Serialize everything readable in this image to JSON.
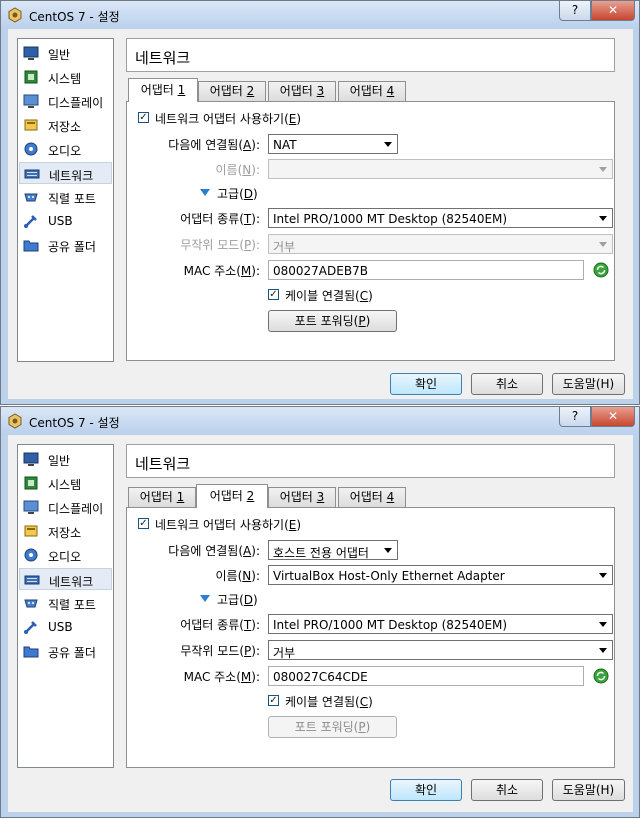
{
  "windows": [
    {
      "title": "CentOS 7 - 설정",
      "title_buttons": {
        "help": "?",
        "close": "✕"
      },
      "sidebar": [
        {
          "label": "일반",
          "icon": "general-icon"
        },
        {
          "label": "시스템",
          "icon": "system-icon"
        },
        {
          "label": "디스플레이",
          "icon": "display-icon"
        },
        {
          "label": "저장소",
          "icon": "storage-icon"
        },
        {
          "label": "오디오",
          "icon": "audio-icon"
        },
        {
          "label": "네트워크",
          "icon": "network-icon",
          "selected": true
        },
        {
          "label": "직렬 포트",
          "icon": "serial-port-icon"
        },
        {
          "label": "USB",
          "icon": "usb-icon"
        },
        {
          "label": "공유 폴더",
          "icon": "shared-folder-icon"
        }
      ],
      "section_title": "네트워크",
      "tabs": [
        {
          "pre": "어댑터 ",
          "key": "1",
          "post": ""
        },
        {
          "pre": "어댑터 ",
          "key": "2",
          "post": ""
        },
        {
          "pre": "어댑터 ",
          "key": "3",
          "post": ""
        },
        {
          "pre": "어댑터 ",
          "key": "4",
          "post": ""
        }
      ],
      "active_tab": 0,
      "enable_adapter": {
        "pre": "네트워크 어댑터 사용하기(",
        "key": "E",
        "post": ")",
        "checked": true
      },
      "attached_to": {
        "pre": "다음에 연결됨(",
        "key": "A",
        "post": "):",
        "value": "NAT"
      },
      "name": {
        "pre": "이름(",
        "key": "N",
        "post": "):",
        "value": "",
        "disabled": true
      },
      "advanced": {
        "pre": "고급(",
        "key": "D",
        "post": ")"
      },
      "adapter_type": {
        "pre": "어댑터 종류(",
        "key": "T",
        "post": "):",
        "value": "Intel PRO/1000 MT Desktop (82540EM)"
      },
      "promiscuous": {
        "pre": "무작위 모드(",
        "key": "P",
        "post": "):",
        "value": "거부",
        "disabled": true
      },
      "mac": {
        "pre": "MAC 주소(",
        "key": "M",
        "post": "):",
        "value": "080027ADEB7B"
      },
      "cable": {
        "pre": "케이블 연결됨(",
        "key": "C",
        "post": ")",
        "checked": true
      },
      "port_forwarding": {
        "pre": "포트 포워딩(",
        "key": "P",
        "post": ")",
        "disabled": false
      },
      "buttons": {
        "ok": "확인",
        "cancel": "취소",
        "help": "도움말(H)"
      }
    },
    {
      "title": "CentOS 7 - 설정",
      "title_buttons": {
        "help": "?",
        "close": "✕"
      },
      "sidebar": [
        {
          "label": "일반",
          "icon": "general-icon"
        },
        {
          "label": "시스템",
          "icon": "system-icon"
        },
        {
          "label": "디스플레이",
          "icon": "display-icon"
        },
        {
          "label": "저장소",
          "icon": "storage-icon"
        },
        {
          "label": "오디오",
          "icon": "audio-icon"
        },
        {
          "label": "네트워크",
          "icon": "network-icon",
          "selected": true
        },
        {
          "label": "직렬 포트",
          "icon": "serial-port-icon"
        },
        {
          "label": "USB",
          "icon": "usb-icon"
        },
        {
          "label": "공유 폴더",
          "icon": "shared-folder-icon"
        }
      ],
      "section_title": "네트워크",
      "tabs": [
        {
          "pre": "어댑터 ",
          "key": "1",
          "post": ""
        },
        {
          "pre": "어댑터 ",
          "key": "2",
          "post": ""
        },
        {
          "pre": "어댑터 ",
          "key": "3",
          "post": ""
        },
        {
          "pre": "어댑터 ",
          "key": "4",
          "post": ""
        }
      ],
      "active_tab": 1,
      "enable_adapter": {
        "pre": "네트워크 어댑터 사용하기(",
        "key": "E",
        "post": ")",
        "checked": true
      },
      "attached_to": {
        "pre": "다음에 연결됨(",
        "key": "A",
        "post": "):",
        "value": "호스트 전용 어댑터"
      },
      "name": {
        "pre": "이름(",
        "key": "N",
        "post": "):",
        "value": "VirtualBox Host-Only Ethernet Adapter",
        "disabled": false
      },
      "advanced": {
        "pre": "고급(",
        "key": "D",
        "post": ")"
      },
      "adapter_type": {
        "pre": "어댑터 종류(",
        "key": "T",
        "post": "):",
        "value": "Intel PRO/1000 MT Desktop (82540EM)"
      },
      "promiscuous": {
        "pre": "무작위 모드(",
        "key": "P",
        "post": "):",
        "value": "거부",
        "disabled": false
      },
      "mac": {
        "pre": "MAC 주소(",
        "key": "M",
        "post": "):",
        "value": "080027C64CDE"
      },
      "cable": {
        "pre": "케이블 연결됨(",
        "key": "C",
        "post": ")",
        "checked": true
      },
      "port_forwarding": {
        "pre": "포트 포워딩(",
        "key": "P",
        "post": ")",
        "disabled": true
      },
      "buttons": {
        "ok": "확인",
        "cancel": "취소",
        "help": "도움말(H)"
      }
    }
  ]
}
